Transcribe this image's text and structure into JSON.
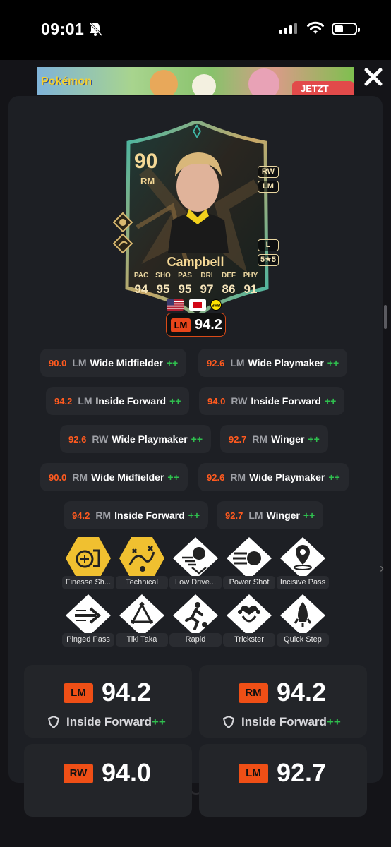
{
  "status_bar": {
    "time": "09:01"
  },
  "ad": {
    "logo_text": "Pokémon",
    "button_label": "JETZT SPIELEN"
  },
  "card": {
    "rating": "90",
    "position": "RM",
    "alt_positions": [
      "RW",
      "LM"
    ],
    "foot": "L",
    "skill_weak": "5★5",
    "name": "Campbell",
    "stats": [
      {
        "label": "PAC",
        "value": "94"
      },
      {
        "label": "SHO",
        "value": "95"
      },
      {
        "label": "PAS",
        "value": "95"
      },
      {
        "label": "DRI",
        "value": "97"
      },
      {
        "label": "DEF",
        "value": "86"
      },
      {
        "label": "PHY",
        "value": "91"
      }
    ],
    "badge_pos": "LM",
    "badge_value": "94.2"
  },
  "roles": [
    {
      "rating": "90.0",
      "pos": "LM",
      "name": "Wide Midfielder",
      "plus": "++"
    },
    {
      "rating": "92.6",
      "pos": "LM",
      "name": "Wide Playmaker",
      "plus": "++"
    },
    {
      "rating": "94.2",
      "pos": "LM",
      "name": "Inside Forward",
      "plus": "++"
    },
    {
      "rating": "94.0",
      "pos": "RW",
      "name": "Inside Forward",
      "plus": "++"
    },
    {
      "rating": "92.6",
      "pos": "RW",
      "name": "Wide Playmaker",
      "plus": "++"
    },
    {
      "rating": "92.7",
      "pos": "RM",
      "name": "Winger",
      "plus": "++"
    },
    {
      "rating": "90.0",
      "pos": "RM",
      "name": "Wide Midfielder",
      "plus": "++"
    },
    {
      "rating": "92.6",
      "pos": "RM",
      "name": "Wide Playmaker",
      "plus": "++"
    },
    {
      "rating": "94.2",
      "pos": "RM",
      "name": "Inside Forward",
      "plus": "++"
    },
    {
      "rating": "92.7",
      "pos": "LM",
      "name": "Winger",
      "plus": "++"
    }
  ],
  "playstyles": [
    {
      "label": "Finesse Sh...",
      "icon": "finesse-shot-icon",
      "plus": true
    },
    {
      "label": "Technical",
      "icon": "technical-icon",
      "plus": true
    },
    {
      "label": "Low Drive...",
      "icon": "low-driven-shot-icon",
      "plus": false
    },
    {
      "label": "Power Shot",
      "icon": "power-shot-icon",
      "plus": false
    },
    {
      "label": "Incisive Pass",
      "icon": "incisive-pass-icon",
      "plus": false
    },
    {
      "label": "Pinged Pass",
      "icon": "pinged-pass-icon",
      "plus": false
    },
    {
      "label": "Tiki Taka",
      "icon": "tiki-taka-icon",
      "plus": false
    },
    {
      "label": "Rapid",
      "icon": "rapid-icon",
      "plus": false
    },
    {
      "label": "Trickster",
      "icon": "trickster-icon",
      "plus": false
    },
    {
      "label": "Quick Step",
      "icon": "quick-step-icon",
      "plus": false
    }
  ],
  "rating_boxes": [
    {
      "pos": "LM",
      "value": "94.2",
      "role": "Inside Forward",
      "plus": "++"
    },
    {
      "pos": "RM",
      "value": "94.2",
      "role": "Inside Forward",
      "plus": "++"
    },
    {
      "pos": "RW",
      "value": "94.0"
    },
    {
      "pos": "LM",
      "value": "92.7"
    }
  ],
  "colors": {
    "accent": "#ef4f16",
    "plus": "#2fc04e",
    "gold": "#f4d896",
    "gold_playstyle": "#f0c030"
  }
}
